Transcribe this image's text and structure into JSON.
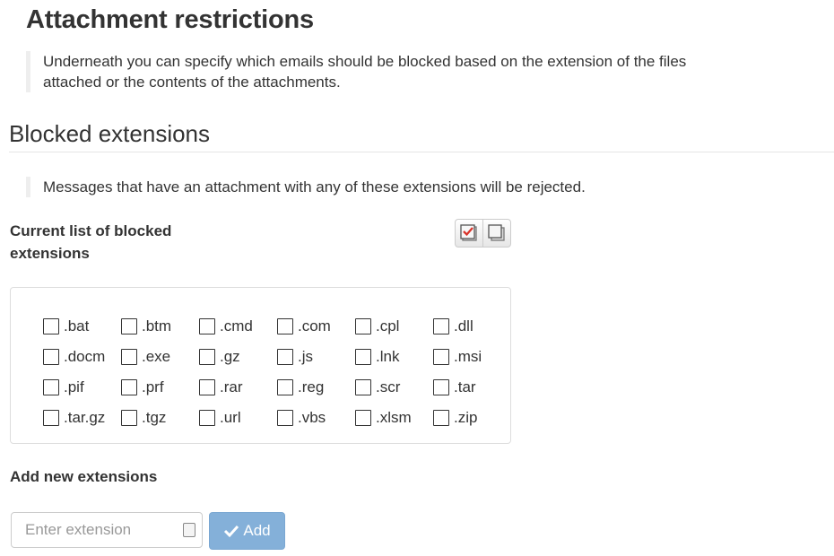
{
  "header": {
    "title": "Attachment restrictions"
  },
  "intro": {
    "text": "Underneath you can specify which emails should be blocked based on the extension of the files attached or the contents of the attachments."
  },
  "blocked_section": {
    "title": "Blocked extensions",
    "description": "Messages that have an attachment with any of these extensions will be rejected.",
    "list_label": "Current list of blocked extensions",
    "extensions": [
      {
        "label": ".bat",
        "checked": false
      },
      {
        "label": ".btm",
        "checked": false
      },
      {
        "label": ".cmd",
        "checked": false
      },
      {
        "label": ".com",
        "checked": false
      },
      {
        "label": ".cpl",
        "checked": false
      },
      {
        "label": ".dll",
        "checked": false
      },
      {
        "label": ".docm",
        "checked": false
      },
      {
        "label": ".exe",
        "checked": false
      },
      {
        "label": ".gz",
        "checked": false
      },
      {
        "label": ".js",
        "checked": false
      },
      {
        "label": ".lnk",
        "checked": false
      },
      {
        "label": ".msi",
        "checked": false
      },
      {
        "label": ".pif",
        "checked": false
      },
      {
        "label": ".prf",
        "checked": false
      },
      {
        "label": ".rar",
        "checked": false
      },
      {
        "label": ".reg",
        "checked": false
      },
      {
        "label": ".scr",
        "checked": false
      },
      {
        "label": ".tar",
        "checked": false
      },
      {
        "label": ".tar.gz",
        "checked": false
      },
      {
        "label": ".tgz",
        "checked": false
      },
      {
        "label": ".url",
        "checked": false
      },
      {
        "label": ".vbs",
        "checked": false
      },
      {
        "label": ".xlsm",
        "checked": false
      },
      {
        "label": ".zip",
        "checked": false
      }
    ]
  },
  "add_section": {
    "label": "Add new extensions",
    "input_value": "",
    "input_placeholder": "Enter extension",
    "add_button_label": "Add"
  },
  "icons": {
    "select_all": "check-all-icon",
    "deselect_all": "uncheck-all-icon",
    "add": "checkmark-icon",
    "input_badge": "contact-card-icon"
  },
  "colors": {
    "accent": "#84b0d9",
    "text": "#333333",
    "check_red": "#d9342b"
  }
}
